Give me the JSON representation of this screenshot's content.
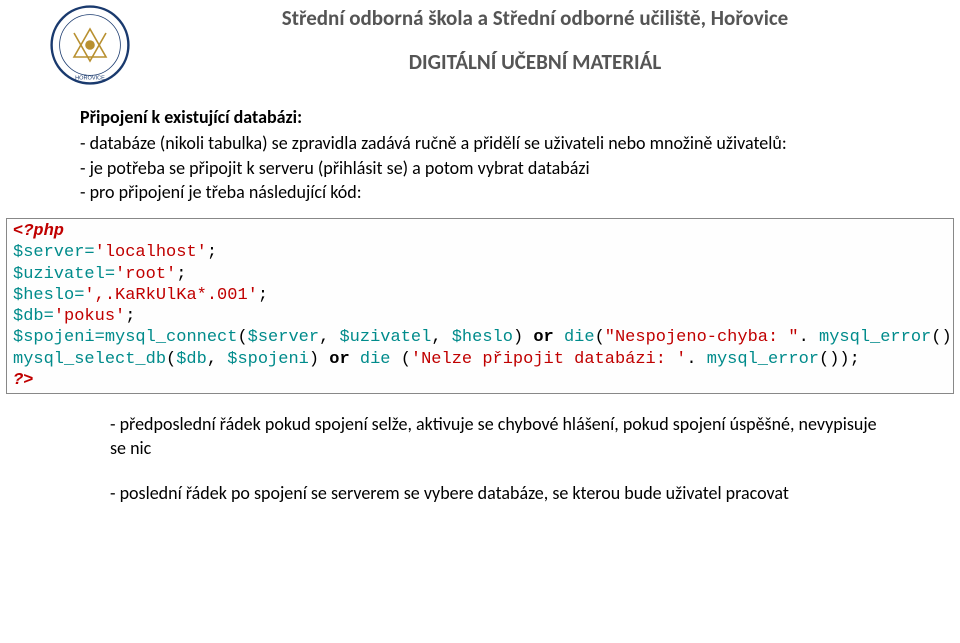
{
  "header": {
    "school_name": "Střední odborná škola a Střední odborné učiliště, Hořovice",
    "subtitle": "DIGITÁLNÍ UČEBNÍ MATERIÁL"
  },
  "content": {
    "section_title": "Připojení k existující databázi:",
    "p1": "- databáze (nikoli tabulka) se zpravidla zadává ručně a přidělí se uživateli nebo množině uživatelů:",
    "p2": "- je potřeba se připojit k serveru (přihlásit se) a potom vybrat databázi",
    "p3": "- pro připojení je třeba následující kód:",
    "p4": "- předposlední řádek pokud spojení selže, aktivuje se chybové hlášení, pokud spojení úspěšné, nevypisuje se nic",
    "p5": "- poslední řádek po spojení se serverem se vybere databáze, se kterou bude uživatel pracovat"
  },
  "code": {
    "open_tag": "<?php",
    "v_server": "$server",
    "s_server": "'localhost'",
    "v_uzivatel": "$uzivatel",
    "s_uzivatel": "'root'",
    "v_heslo": "$heslo",
    "s_heslo": "',.KaRkUlKa*.001'",
    "v_db": "$db",
    "s_db": "'pokus'",
    "v_spojeni": "$spojeni",
    "f_connect": "mysql_connect",
    "f_select": "mysql_select_db",
    "f_die": "die",
    "f_error": "mysql_error",
    "kw_or": "or",
    "s_err1": "\"Nespojeno-chyba: \"",
    "s_err2": "'Nelze připojit databázi: '",
    "close_tag": "?>",
    "eq": "=",
    "semi": ";",
    "dot": ". ",
    "comma": ", ",
    "lp": "(",
    "rp": ")",
    "lp2": "(",
    "rp2": ")",
    "cursor": "|"
  }
}
